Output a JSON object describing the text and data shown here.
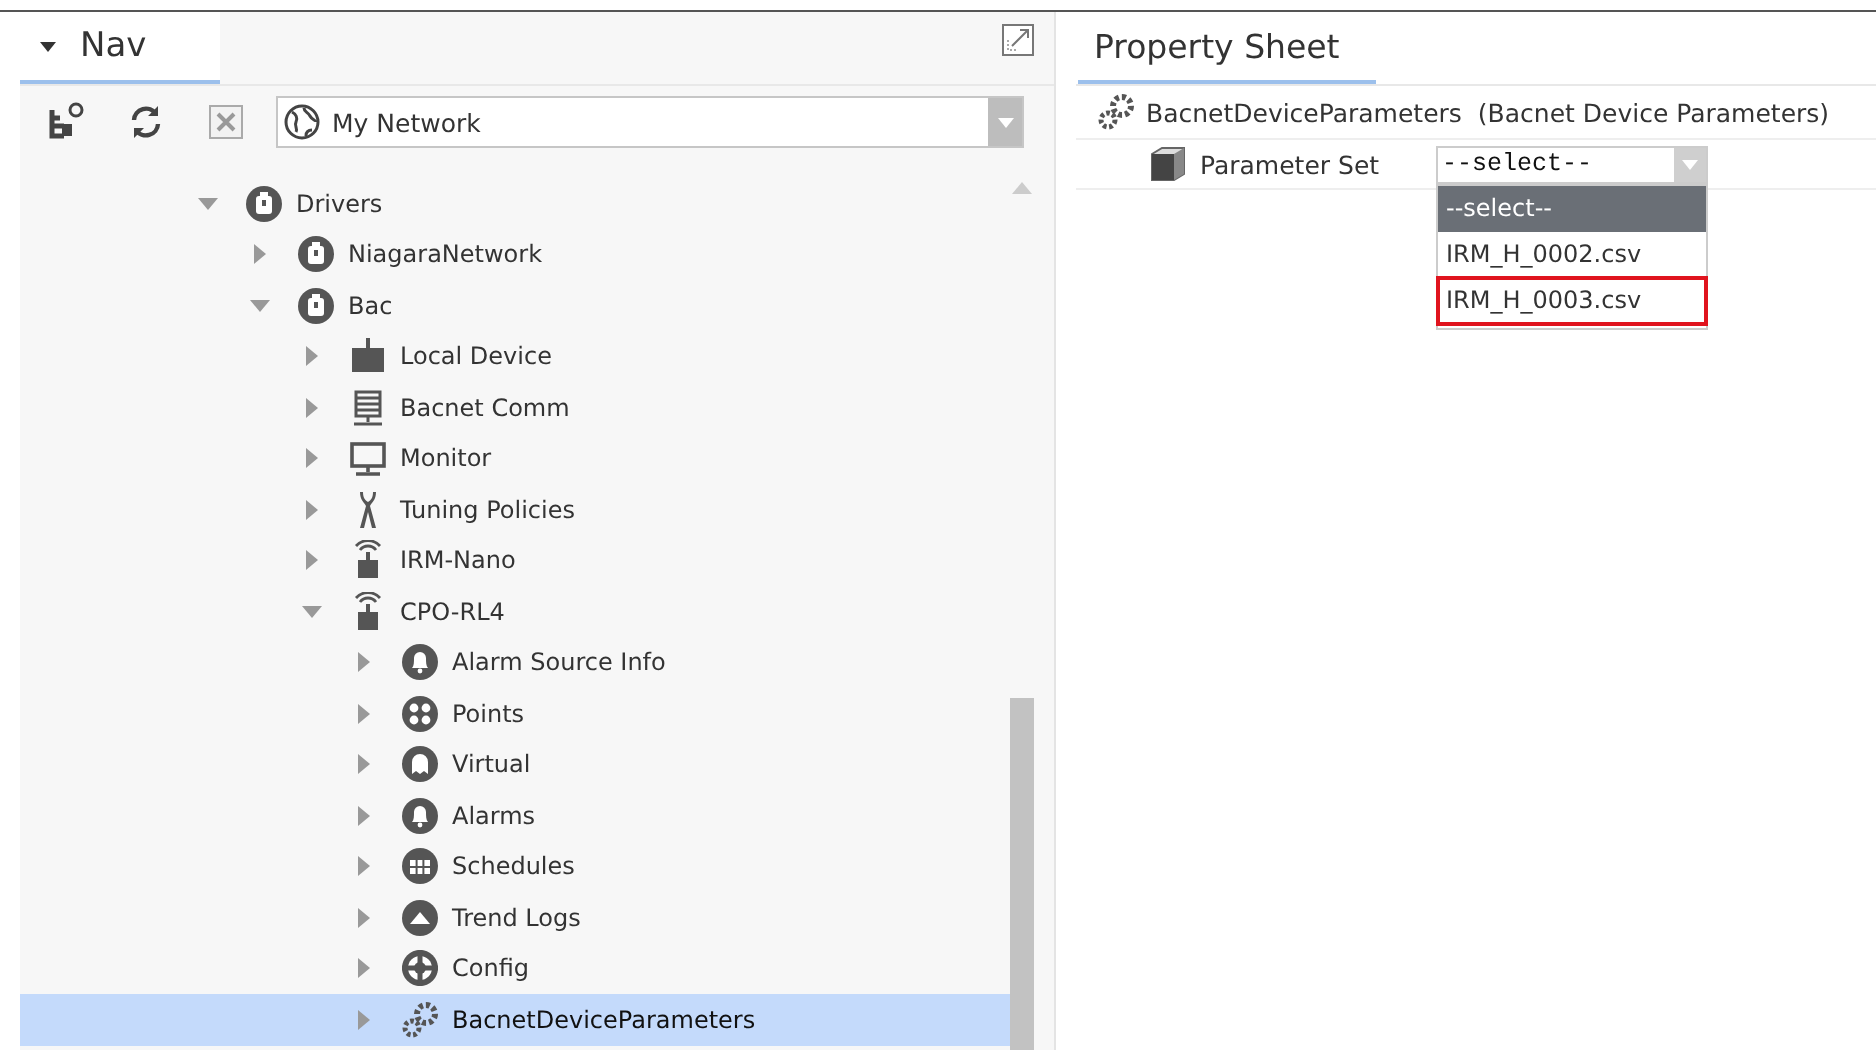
{
  "nav": {
    "title": "Nav",
    "network": "My Network",
    "tree": [
      {
        "label": "Drivers",
        "kind": "driver",
        "expanded": true,
        "selected": false,
        "children": [
          {
            "label": "NiagaraNetwork",
            "kind": "driver",
            "expanded": false,
            "selected": false
          },
          {
            "label": "Bac",
            "kind": "driver",
            "expanded": true,
            "selected": false,
            "children": [
              {
                "label": "Local Device",
                "kind": "device",
                "expanded": false,
                "selected": false
              },
              {
                "label": "Bacnet Comm",
                "kind": "server",
                "expanded": false,
                "selected": false
              },
              {
                "label": "Monitor",
                "kind": "monitor",
                "expanded": false,
                "selected": false
              },
              {
                "label": "Tuning Policies",
                "kind": "tool",
                "expanded": false,
                "selected": false
              },
              {
                "label": "IRM-Nano",
                "kind": "wireless",
                "expanded": false,
                "selected": false
              },
              {
                "label": "CPO-RL4",
                "kind": "wireless",
                "expanded": true,
                "selected": false,
                "children": [
                  {
                    "label": "Alarm Source Info",
                    "kind": "bell",
                    "expanded": false,
                    "selected": false
                  },
                  {
                    "label": "Points",
                    "kind": "points",
                    "expanded": false,
                    "selected": false
                  },
                  {
                    "label": "Virtual",
                    "kind": "ghost",
                    "expanded": false,
                    "selected": false
                  },
                  {
                    "label": "Alarms",
                    "kind": "bell",
                    "expanded": false,
                    "selected": false
                  },
                  {
                    "label": "Schedules",
                    "kind": "schedule",
                    "expanded": false,
                    "selected": false
                  },
                  {
                    "label": "Trend Logs",
                    "kind": "trend",
                    "expanded": false,
                    "selected": false
                  },
                  {
                    "label": "Config",
                    "kind": "config",
                    "expanded": false,
                    "selected": false
                  },
                  {
                    "label": "BacnetDeviceParameters",
                    "kind": "gears",
                    "expanded": false,
                    "selected": true
                  }
                ]
              }
            ]
          }
        ]
      }
    ]
  },
  "property_sheet": {
    "title": "Property Sheet",
    "object": "BacnetDeviceParameters",
    "object_type": "(Bacnet Device Parameters)",
    "property": {
      "label": "Parameter Set",
      "value": "--select--",
      "options": [
        {
          "label": "--select--",
          "selected": true,
          "highlighted": false
        },
        {
          "label": "IRM_H_0002.csv",
          "selected": false,
          "highlighted": false
        },
        {
          "label": "IRM_H_0003.csv",
          "selected": false,
          "highlighted": true
        }
      ]
    }
  }
}
